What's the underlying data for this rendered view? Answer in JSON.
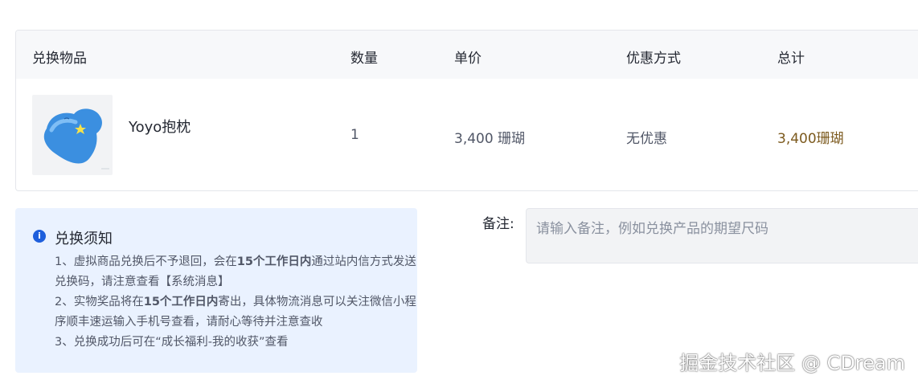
{
  "table": {
    "headers": {
      "item": "兑换物品",
      "quantity": "数量",
      "unit_price": "单价",
      "discount": "优惠方式",
      "total": "总计"
    },
    "row": {
      "name": "Yoyo抱枕",
      "quantity": "1",
      "unit_price": "3,400 珊瑚",
      "discount": "无优惠",
      "total": "3,400珊瑚"
    }
  },
  "notice": {
    "title": "兑换须知",
    "lines": [
      {
        "pre": "1、虚拟商品兑换后不予退回，会在",
        "bold": "15个工作日内",
        "post": "通过站内信方式发送兑换码，请注意查看【系统消息】"
      },
      {
        "pre": "2、实物奖品将在",
        "bold": "15个工作日内",
        "post": "寄出，具体物流消息可以关注微信小程序顺丰速运输入手机号查看，请耐心等待并注意查收"
      },
      {
        "pre": "3、兑换成功后可在“成长福利-我的收获”查看",
        "bold": "",
        "post": ""
      }
    ]
  },
  "remark": {
    "label": "备注:",
    "placeholder": "请输入备注，例如兑换产品的期望尺码"
  },
  "watermark": "掘金技术社区 @ CDream",
  "colors": {
    "header_bg": "#f7f8fa",
    "notice_bg": "#eaf2ff",
    "notice_icon": "#1e5fdc",
    "total_text": "#7c5a1e"
  }
}
